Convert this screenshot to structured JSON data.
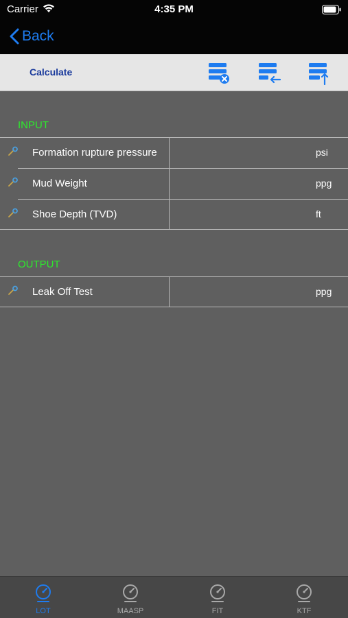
{
  "status_bar": {
    "carrier": "Carrier",
    "time": "4:35 PM"
  },
  "nav": {
    "back_label": "Back"
  },
  "toolbar": {
    "calculate_label": "Calculate",
    "icons": [
      "clear-table-icon",
      "import-table-icon",
      "export-table-icon"
    ]
  },
  "input": {
    "header": "INPUT",
    "rows": [
      {
        "label": "Formation rupture pressure",
        "unit": "psi",
        "value": ""
      },
      {
        "label": "Mud Weight",
        "unit": "ppg",
        "value": ""
      },
      {
        "label": "Shoe Depth (TVD)",
        "unit": "ft",
        "value": ""
      }
    ]
  },
  "output": {
    "header": "OUTPUT",
    "rows": [
      {
        "label": "Leak Off Test",
        "unit": "ppg",
        "value": ""
      }
    ]
  },
  "tabs": [
    {
      "label": "LOT",
      "selected": true
    },
    {
      "label": "MAASP",
      "selected": false
    },
    {
      "label": "FIT",
      "selected": false
    },
    {
      "label": "KTF",
      "selected": false
    }
  ],
  "colors": {
    "accent": "#1e7cf0",
    "section_header": "#2dea2d",
    "tab_inactive": "#a9a9a9",
    "background": "#5f5f5f"
  }
}
